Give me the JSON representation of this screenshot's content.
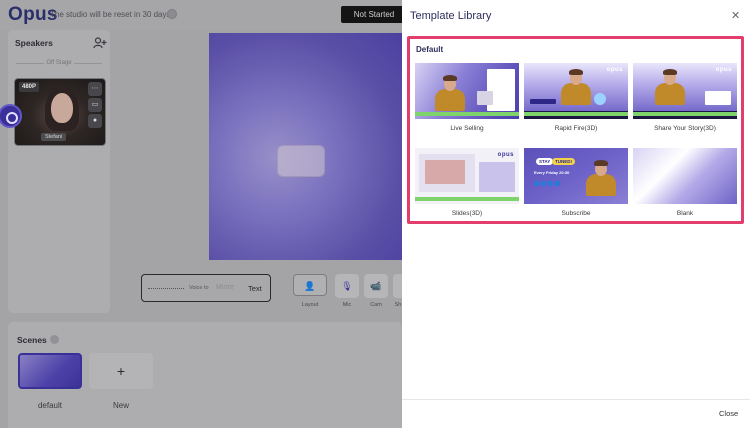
{
  "app": {
    "logo": "Opus",
    "reset_notice": "The studio will be reset in 30 days.",
    "status": "Not Started"
  },
  "speakers": {
    "title": "Speakers",
    "offstage_label": "Off Stage",
    "card": {
      "resolution": "480P",
      "name": "Stefani"
    }
  },
  "voice": {
    "to_label": "Voice to",
    "mirror_label": "Mirror",
    "text_label": "Text"
  },
  "toolbar": {
    "layout": "Layout",
    "mic": "Mic",
    "cam": "Cam",
    "more": "Sh"
  },
  "scenes": {
    "title": "Scenes",
    "items": [
      {
        "label": "default"
      },
      {
        "label": "New",
        "glyph": "+"
      }
    ]
  },
  "drawer": {
    "title": "Template Library",
    "close_glyph": "✕",
    "section": "Default",
    "templates": [
      {
        "label": "Live Selling"
      },
      {
        "label": "Rapid Fire(3D)"
      },
      {
        "label": "Share Your Story(3D)"
      },
      {
        "label": "Slides(3D)"
      },
      {
        "label": "Subscribe"
      },
      {
        "label": "Blank"
      }
    ],
    "footer_close": "Close"
  },
  "thumb_text": {
    "opus": "opus",
    "stay": "STAY",
    "tuned": "TUNED!",
    "friday": "Every Friday 20:30"
  },
  "colors": {
    "accent": "#3b3599",
    "highlight_border": "#e23d6c",
    "drawer_bg": "#ffffff"
  }
}
